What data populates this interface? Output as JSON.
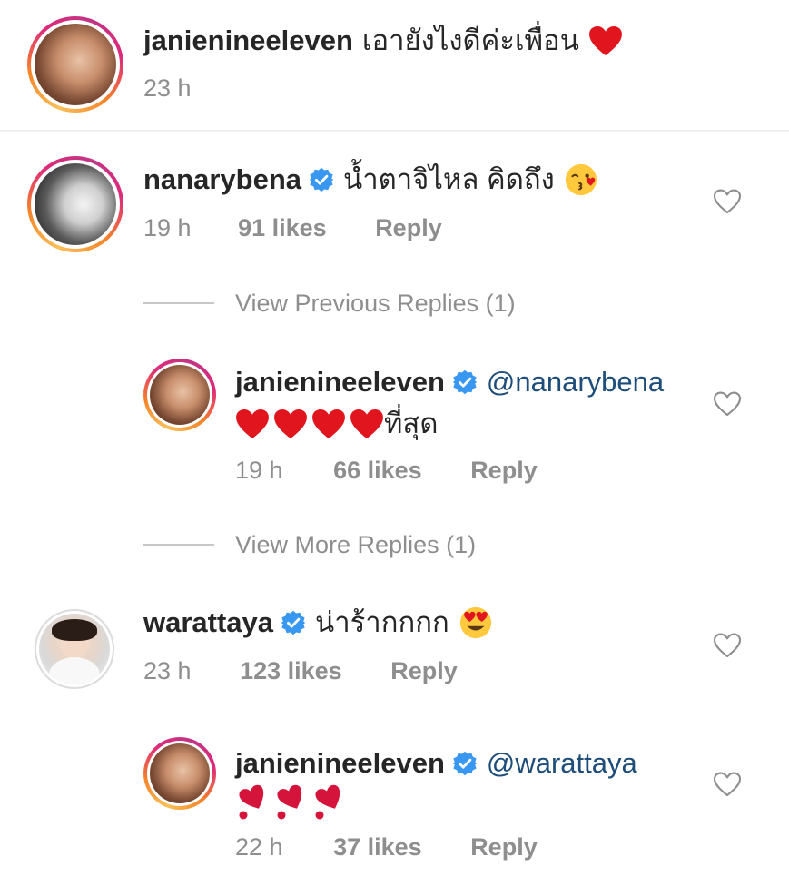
{
  "caption": {
    "username": "janienineeleven",
    "text": "เอายังไงดีค่ะเพื่อน",
    "emoji": "red-heart",
    "time": "23 h"
  },
  "comments": [
    {
      "username": "nanarybena",
      "verified": true,
      "text": "น้ำตาจิไหล คิดถึง",
      "emoji": "face-blowing-kiss",
      "time": "19 h",
      "likes": "91 likes",
      "reply": "Reply",
      "view_replies": "View Previous Replies (1)",
      "replies": [
        {
          "username": "janienineeleven",
          "verified": true,
          "mention": "@nanarybena",
          "text_line2": "ที่สุด",
          "hearts": 4,
          "time": "19 h",
          "likes": "66 likes",
          "reply": "Reply"
        }
      ],
      "view_more": "View More Replies (1)"
    },
    {
      "username": "warattaya",
      "verified": true,
      "text": "น่าร้ากกกก",
      "emoji": "heart-eyes-face",
      "time": "23 h",
      "likes": "123 likes",
      "reply": "Reply",
      "replies": [
        {
          "username": "janienineeleven",
          "verified": true,
          "mention": "@warattaya",
          "hearts": 3,
          "heart_style": "heart-exclamation",
          "time": "22 h",
          "likes": "37 likes",
          "reply": "Reply"
        }
      ]
    }
  ],
  "colors": {
    "text": "#262626",
    "secondary": "#8e8e8e",
    "mention": "#1e4d7a",
    "verified": "#3897f0",
    "heart": "#e0151e"
  }
}
